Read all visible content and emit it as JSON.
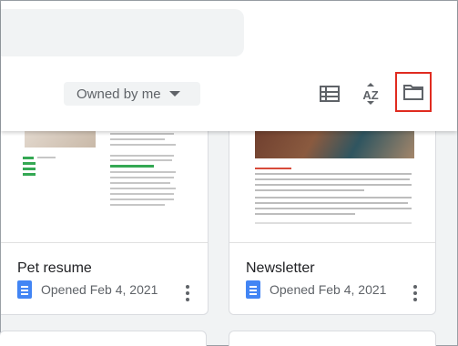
{
  "filter": {
    "label": "Owned by me"
  },
  "toolbar": {
    "list_view_icon": "list-view-icon",
    "sort_icon": "sort-az-icon",
    "az_label": "AZ",
    "folder_icon": "folder-icon",
    "highlight_color": "#e02b20"
  },
  "files": [
    {
      "title": "Pet resume",
      "meta": "Opened Feb 4, 2021",
      "icon": "docs-icon"
    },
    {
      "title": "Newsletter",
      "meta": "Opened Feb 4, 2021",
      "icon": "docs-icon"
    }
  ]
}
